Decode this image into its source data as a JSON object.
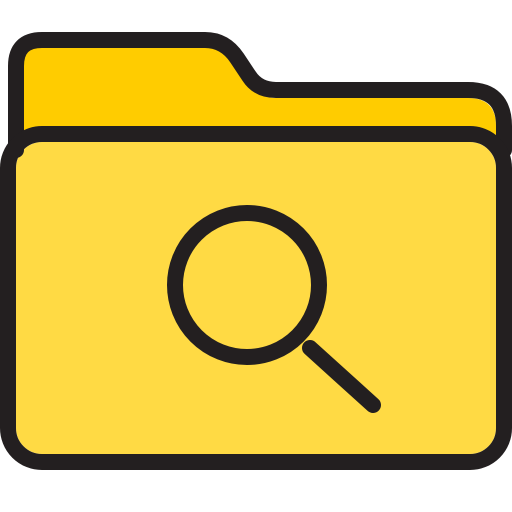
{
  "icon": {
    "name": "folder-search-icon",
    "colors": {
      "tab_fill": "#FFCC00",
      "body_fill": "#FFDA44",
      "outline": "#231F20",
      "background": "#FFFFFF"
    }
  }
}
